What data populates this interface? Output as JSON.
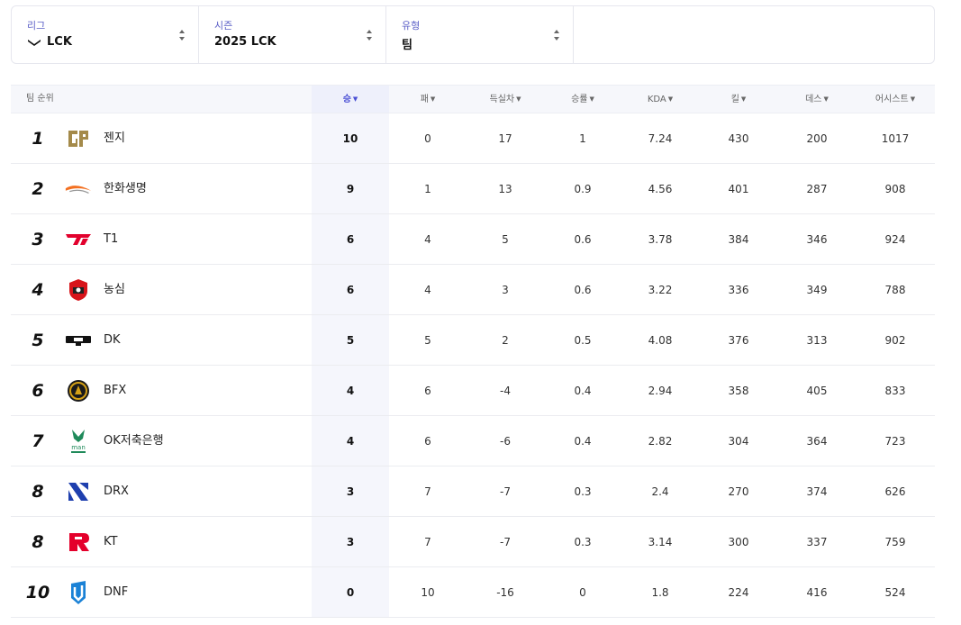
{
  "filters": [
    {
      "label": "리그",
      "value": "LCK",
      "icon": "lck-logo-icon"
    },
    {
      "label": "시즌",
      "value": "2025 LCK"
    },
    {
      "label": "유형",
      "value": "팀"
    }
  ],
  "table": {
    "rank_header": "팀 순위",
    "columns": [
      {
        "key": "win",
        "label": "승",
        "active": true
      },
      {
        "key": "loss",
        "label": "패"
      },
      {
        "key": "diff",
        "label": "득실차"
      },
      {
        "key": "winrate",
        "label": "승률"
      },
      {
        "key": "kda",
        "label": "KDA"
      },
      {
        "key": "kills",
        "label": "킬"
      },
      {
        "key": "deaths",
        "label": "데스"
      },
      {
        "key": "assists",
        "label": "어시스트"
      }
    ],
    "rows": [
      {
        "rank": "1",
        "team": "젠지",
        "logo": "geng",
        "win": "10",
        "loss": "0",
        "diff": "17",
        "winrate": "1",
        "kda": "7.24",
        "kills": "430",
        "deaths": "200",
        "assists": "1017"
      },
      {
        "rank": "2",
        "team": "한화생명",
        "logo": "hle",
        "win": "9",
        "loss": "1",
        "diff": "13",
        "winrate": "0.9",
        "kda": "4.56",
        "kills": "401",
        "deaths": "287",
        "assists": "908"
      },
      {
        "rank": "3",
        "team": "T1",
        "logo": "t1",
        "win": "6",
        "loss": "4",
        "diff": "5",
        "winrate": "0.6",
        "kda": "3.78",
        "kills": "384",
        "deaths": "346",
        "assists": "924"
      },
      {
        "rank": "4",
        "team": "농심",
        "logo": "ns",
        "win": "6",
        "loss": "4",
        "diff": "3",
        "winrate": "0.6",
        "kda": "3.22",
        "kills": "336",
        "deaths": "349",
        "assists": "788"
      },
      {
        "rank": "5",
        "team": "DK",
        "logo": "dk",
        "win": "5",
        "loss": "5",
        "diff": "2",
        "winrate": "0.5",
        "kda": "4.08",
        "kills": "376",
        "deaths": "313",
        "assists": "902"
      },
      {
        "rank": "6",
        "team": "BFX",
        "logo": "bfx",
        "win": "4",
        "loss": "6",
        "diff": "-4",
        "winrate": "0.4",
        "kda": "2.94",
        "kills": "358",
        "deaths": "405",
        "assists": "833"
      },
      {
        "rank": "7",
        "team": "OK저축은행",
        "logo": "bro",
        "win": "4",
        "loss": "6",
        "diff": "-6",
        "winrate": "0.4",
        "kda": "2.82",
        "kills": "304",
        "deaths": "364",
        "assists": "723"
      },
      {
        "rank": "8",
        "team": "DRX",
        "logo": "drx",
        "win": "3",
        "loss": "7",
        "diff": "-7",
        "winrate": "0.3",
        "kda": "2.4",
        "kills": "270",
        "deaths": "374",
        "assists": "626"
      },
      {
        "rank": "8",
        "team": "KT",
        "logo": "kt",
        "win": "3",
        "loss": "7",
        "diff": "-7",
        "winrate": "0.3",
        "kda": "3.14",
        "kills": "300",
        "deaths": "337",
        "assists": "759"
      },
      {
        "rank": "10",
        "team": "DNF",
        "logo": "dnf",
        "win": "0",
        "loss": "10",
        "diff": "-16",
        "winrate": "0",
        "kda": "1.8",
        "kills": "224",
        "deaths": "416",
        "assists": "524"
      }
    ]
  },
  "colors": {
    "accent": "#4a4fd4",
    "label": "#5b5fc7",
    "highlight": "#f5f6fc"
  }
}
